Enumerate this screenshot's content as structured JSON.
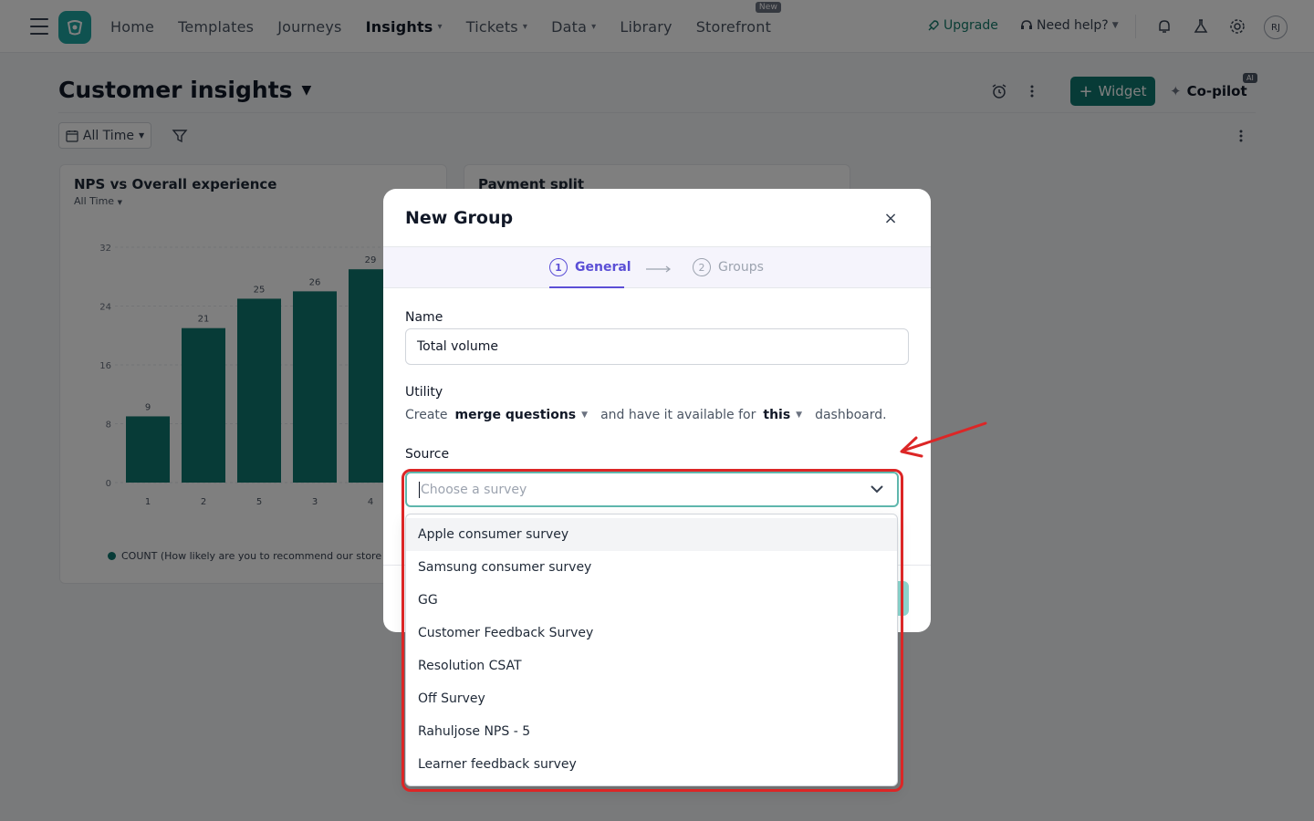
{
  "nav": {
    "items": [
      {
        "label": "Home",
        "has_dropdown": false,
        "active": false
      },
      {
        "label": "Templates",
        "has_dropdown": false,
        "active": false
      },
      {
        "label": "Journeys",
        "has_dropdown": false,
        "active": false
      },
      {
        "label": "Insights",
        "has_dropdown": true,
        "active": true
      },
      {
        "label": "Tickets",
        "has_dropdown": true,
        "active": false
      },
      {
        "label": "Data",
        "has_dropdown": true,
        "active": false
      },
      {
        "label": "Library",
        "has_dropdown": false,
        "active": false
      },
      {
        "label": "Storefront",
        "has_dropdown": false,
        "active": false
      }
    ],
    "new_badge": "New",
    "upgrade": "Upgrade",
    "need_help": "Need help?",
    "avatar_initials": "RJ"
  },
  "header": {
    "title": "Customer insights",
    "widget_button": "Widget",
    "copilot": "Co-pilot",
    "ai_badge": "AI",
    "time_filter": "All Time"
  },
  "cards": {
    "nps": {
      "title": "NPS vs Overall experience",
      "subtitle": "All Time",
      "legend": "COUNT (How likely are you to recommend our store to a fri"
    },
    "payment": {
      "title": "Payment split"
    }
  },
  "chart_data": {
    "type": "bar",
    "categories": [
      "1",
      "2",
      "5",
      "3",
      "4"
    ],
    "values": [
      9,
      21,
      25,
      26,
      29
    ],
    "ylim": [
      0,
      32
    ],
    "yticks": [
      0,
      8,
      16,
      24,
      32
    ],
    "grid": true,
    "color": "#0f766e"
  },
  "modal": {
    "title": "New Group",
    "close_glyph": "×",
    "steps": [
      {
        "num": "1",
        "label": "General"
      },
      {
        "num": "2",
        "label": "Groups"
      }
    ],
    "name_label": "Name",
    "name_value": "Total volume",
    "utility_label": "Utility",
    "utility": {
      "create": "Create",
      "merge": "merge questions",
      "middle": "and have it available for",
      "scope": "this",
      "end": "dashboard."
    },
    "source_label": "Source",
    "source_placeholder": "Choose a survey",
    "survey_options": [
      "Apple consumer survey",
      "Samsung consumer survey",
      "GG",
      "Customer Feedback Survey",
      "Resolution CSAT",
      "Off Survey",
      "Rahuljose NPS - 5",
      "Learner feedback survey"
    ]
  },
  "colors": {
    "accent_teal": "#0f766e",
    "step_active": "#5b4fd6",
    "annotation_red": "#dc2626"
  }
}
